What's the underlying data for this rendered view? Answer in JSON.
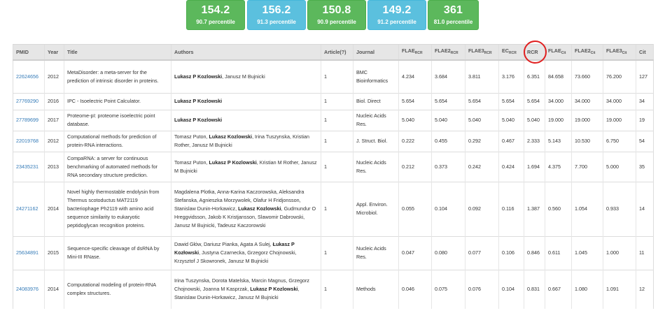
{
  "stats": [
    {
      "value": "154.2",
      "percentile": "90.7 percentile",
      "color": "green"
    },
    {
      "value": "156.2",
      "percentile": "91.3 percentile",
      "color": "blue"
    },
    {
      "value": "150.8",
      "percentile": "90.9 percentile",
      "color": "green"
    },
    {
      "value": "149.2",
      "percentile": "91.2 percentile",
      "color": "blue"
    },
    {
      "value": "361",
      "percentile": "81.0 percentile",
      "color": "green"
    }
  ],
  "columns": {
    "pmid": "PMID",
    "year": "Year",
    "title": "Title",
    "authors": "Authors",
    "article": "Article(?)",
    "journal": "Journal",
    "flae_rcr": {
      "base": "FLAE",
      "sub": "RCR"
    },
    "flae2_rcr": {
      "base": "FLAE2",
      "sub": "RCR"
    },
    "flae3_rcr": {
      "base": "FLAE3",
      "sub": "RCR"
    },
    "ec_rcr": {
      "base": "EC",
      "sub": "RCR"
    },
    "rcr": "RCR",
    "flae_cit": {
      "base": "FLAE",
      "sub": "Cit"
    },
    "flae2_cit": {
      "base": "FLAE2",
      "sub": "Cit"
    },
    "flae3_cit": {
      "base": "FLAE3",
      "sub": "Cit"
    },
    "cit": "Cit"
  },
  "rows": [
    {
      "pmid": "22624656",
      "year": "2012",
      "title": "MetaDisorder: a meta-server for the prediction of intrinsic disorder in proteins.",
      "authors": [
        {
          "t": "Lukasz P Kozlowski",
          "b": true
        },
        {
          "t": ", Janusz M Bujnicki",
          "b": false
        }
      ],
      "article": "1",
      "journal": "BMC Bioinformatics",
      "flae_rcr": "4.234",
      "flae2_rcr": "3.684",
      "flae3_rcr": "3.811",
      "ec_rcr": "3.176",
      "rcr": "6.351",
      "flae_cit": "84.658",
      "flae2_cit": "73.660",
      "flae3_cit": "76.200",
      "cit": "127"
    },
    {
      "pmid": "27769290",
      "year": "2016",
      "title": "IPC - Isoelectric Point Calculator.",
      "authors": [
        {
          "t": "Lukasz P Kozlowski",
          "b": true
        }
      ],
      "article": "1",
      "journal": "Biol. Direct",
      "flae_rcr": "5.654",
      "flae2_rcr": "5.654",
      "flae3_rcr": "5.654",
      "ec_rcr": "5.654",
      "rcr": "5.654",
      "flae_cit": "34.000",
      "flae2_cit": "34.000",
      "flae3_cit": "34.000",
      "cit": "34"
    },
    {
      "pmid": "27789699",
      "year": "2017",
      "title": "Proteome-pI: proteome isoelectric point database.",
      "authors": [
        {
          "t": "Lukasz P Kozlowski",
          "b": true
        }
      ],
      "article": "1",
      "journal": "Nucleic Acids Res.",
      "flae_rcr": "5.040",
      "flae2_rcr": "5.040",
      "flae3_rcr": "5.040",
      "ec_rcr": "5.040",
      "rcr": "5.040",
      "flae_cit": "19.000",
      "flae2_cit": "19.000",
      "flae3_cit": "19.000",
      "cit": "19"
    },
    {
      "pmid": "22019768",
      "year": "2012",
      "title": "Computational methods for prediction of protein-RNA interactions.",
      "authors": [
        {
          "t": "Tomasz Puton, ",
          "b": false
        },
        {
          "t": "Lukasz Kozlowski",
          "b": true
        },
        {
          "t": ", Irina Tuszynska, Kristian Rother, Janusz M Bujnicki",
          "b": false
        }
      ],
      "article": "1",
      "journal": "J. Struct. Biol.",
      "flae_rcr": "0.222",
      "flae2_rcr": "0.455",
      "flae3_rcr": "0.292",
      "ec_rcr": "0.467",
      "rcr": "2.333",
      "flae_cit": "5.143",
      "flae2_cit": "10.530",
      "flae3_cit": "6.750",
      "cit": "54"
    },
    {
      "pmid": "23435231",
      "year": "2013",
      "title": "CompaRNA: a server for continuous benchmarking of automated methods for RNA secondary structure prediction.",
      "authors": [
        {
          "t": "Tomasz Puton, ",
          "b": false
        },
        {
          "t": "Lukasz P Kozlowski",
          "b": true
        },
        {
          "t": ", Kristian M Rother, Janusz M Bujnicki",
          "b": false
        }
      ],
      "article": "1",
      "journal": "Nucleic Acids Res.",
      "flae_rcr": "0.212",
      "flae2_rcr": "0.373",
      "flae3_rcr": "0.242",
      "ec_rcr": "0.424",
      "rcr": "1.694",
      "flae_cit": "4.375",
      "flae2_cit": "7.700",
      "flae3_cit": "5.000",
      "cit": "35"
    },
    {
      "pmid": "24271162",
      "year": "2014",
      "title": "Novel highly thermostable endolysin from Thermus scotoductus MAT2119 bacteriophage Ph2119 with amino acid sequence similarity to eukaryotic peptidoglycan recognition proteins.",
      "authors": [
        {
          "t": "Magdalena Plotka, Anna-Karina Kaczorowska, Aleksandra Stefanska, Agnieszka Morzywolek, Olafur H Fridjonsson, Stanislaw Dunin-Horkawicz, ",
          "b": false
        },
        {
          "t": "Lukasz Kozlowski",
          "b": true
        },
        {
          "t": ", Gudmundur O Hreggvidsson, Jakob K Kristjansson, Slawomir Dabrowski, Janusz M Bujnicki, Tadeusz Kaczorowski",
          "b": false
        }
      ],
      "article": "1",
      "journal": "Appl. Environ. Microbiol.",
      "flae_rcr": "0.055",
      "flae2_rcr": "0.104",
      "flae3_rcr": "0.092",
      "ec_rcr": "0.116",
      "rcr": "1.387",
      "flae_cit": "0.560",
      "flae2_cit": "1.054",
      "flae3_cit": "0.933",
      "cit": "14"
    },
    {
      "pmid": "25634891",
      "year": "2015",
      "title": "Sequence-specific cleavage of dsRNA by Mini-III RNase.",
      "authors": [
        {
          "t": "Dawid Głów, Dariusz Pianka, Agata A Sulej, ",
          "b": false
        },
        {
          "t": "Łukasz P Kozłowski",
          "b": true
        },
        {
          "t": ", Justyna Czarnecka, Grzegorz Chojnowski, Krzysztof J Skowronek, Janusz M Bujnicki",
          "b": false
        }
      ],
      "article": "1",
      "journal": "Nucleic Acids Res.",
      "flae_rcr": "0.047",
      "flae2_rcr": "0.080",
      "flae3_rcr": "0.077",
      "ec_rcr": "0.106",
      "rcr": "0.846",
      "flae_cit": "0.611",
      "flae2_cit": "1.045",
      "flae3_cit": "1.000",
      "cit": "11"
    },
    {
      "pmid": "24083976",
      "year": "2014",
      "title": "Computational modeling of protein-RNA complex structures.",
      "authors": [
        {
          "t": "Irina Tuszynska, Dorota Matelska, Marcin Magnus, Grzegorz Chojnowski, Joanna M Kasprzak, ",
          "b": false
        },
        {
          "t": "Lukasz P Kozlowski",
          "b": true
        },
        {
          "t": ", Stanislaw Dunin-Horkawicz, Janusz M Bujnicki",
          "b": false
        }
      ],
      "article": "1",
      "journal": "Methods",
      "flae_rcr": "0.046",
      "flae2_rcr": "0.075",
      "flae3_rcr": "0.076",
      "ec_rcr": "0.104",
      "rcr": "0.831",
      "flae_cit": "0.667",
      "flae2_cit": "1.080",
      "flae3_cit": "1.091",
      "cit": "12"
    }
  ]
}
